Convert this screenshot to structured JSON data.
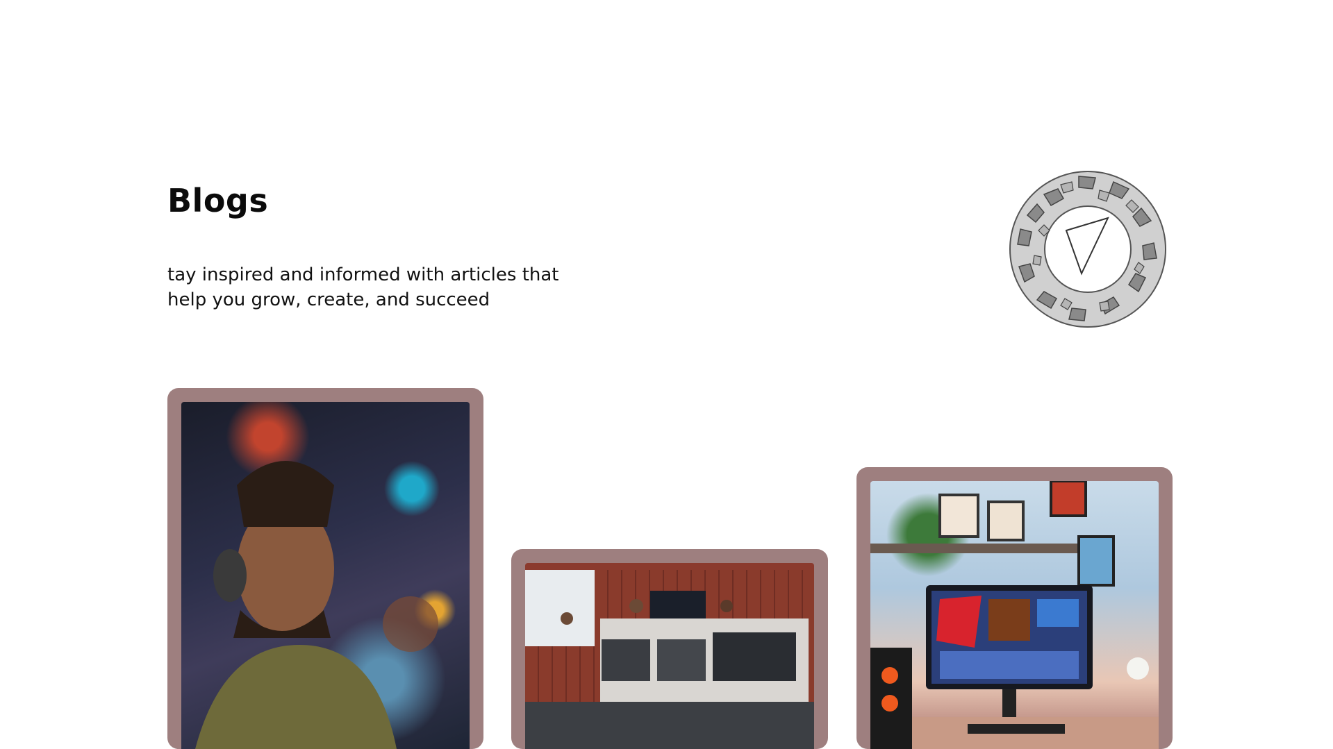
{
  "header": {
    "title": "Blogs",
    "subtitle_line1": "tay inspired and informed with articles that",
    "subtitle_line2": "help you grow, create, and succeed"
  },
  "emblem": {
    "icon": "mosaic-ring-logo"
  },
  "cards": [
    {
      "image_description_icon": "photo-man-headphones"
    },
    {
      "image_description_icon": "photo-office-team"
    },
    {
      "image_description_icon": "photo-desk-monitor"
    }
  ],
  "colors": {
    "card_frame": "#9e7f7f",
    "text": "#0b0b0b",
    "background": "#ffffff"
  }
}
